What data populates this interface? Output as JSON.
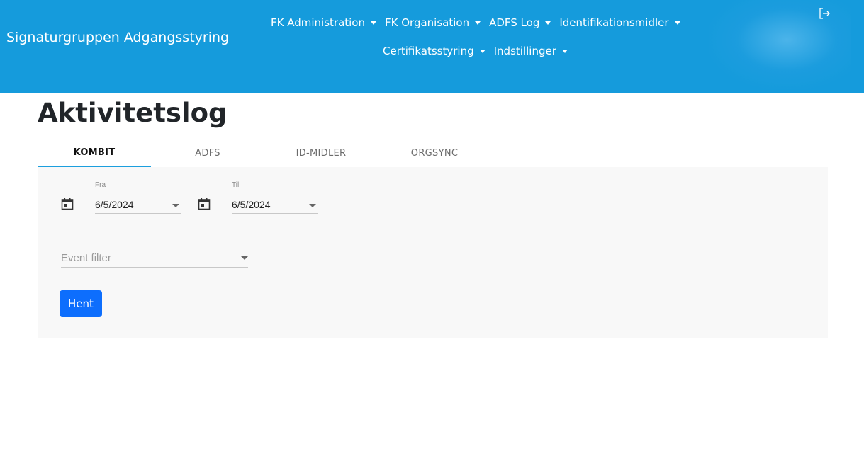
{
  "header": {
    "brand": "Signaturgruppen Adgangsstyring",
    "nav_row1": [
      {
        "label": "FK Administration"
      },
      {
        "label": "FK Organisation"
      },
      {
        "label": "ADFS Log"
      },
      {
        "label": "Identifikationsmidler"
      }
    ],
    "nav_row2": [
      {
        "label": "Certifikatsstyring"
      },
      {
        "label": "Indstillinger"
      }
    ],
    "logout_icon": "logout-icon",
    "colors": {
      "background": "#159bdc",
      "text": "#ffffff"
    }
  },
  "page": {
    "title": "Aktivitetslog"
  },
  "tabs": [
    {
      "label": "KOMBIT",
      "active": true
    },
    {
      "label": "ADFS",
      "active": false
    },
    {
      "label": "ID-MIDLER",
      "active": false
    },
    {
      "label": "ORGSYNC",
      "active": false
    }
  ],
  "filters": {
    "from": {
      "label": "Fra",
      "value": "6/5/2024",
      "icon": "calendar-icon"
    },
    "to": {
      "label": "Til",
      "value": "6/5/2024",
      "icon": "calendar-icon"
    },
    "event_filter": {
      "placeholder": "Event filter",
      "value": ""
    }
  },
  "actions": {
    "fetch_label": "Hent",
    "fetch_color": "#0d6efd"
  }
}
